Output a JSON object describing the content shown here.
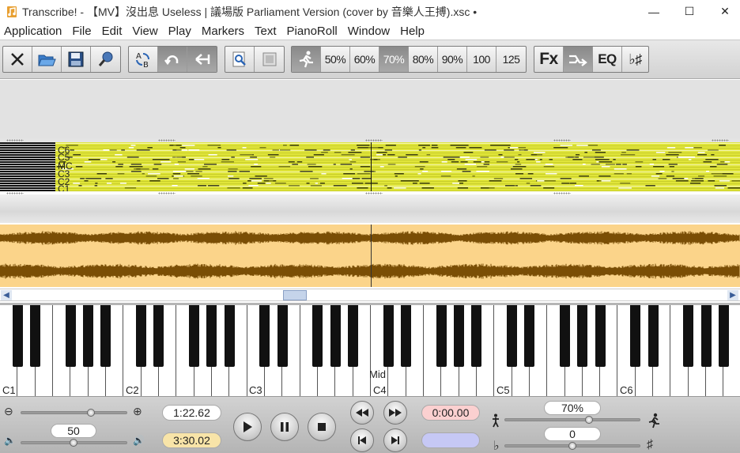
{
  "window": {
    "title": "Transcribe! - 【MV】沒出息 Useless | 議場版 Parliament Version (cover by 音樂人王搏).xsc •",
    "minimize": "—",
    "maximize": "☐",
    "close": "✕"
  },
  "menu": [
    "Application",
    "File",
    "Edit",
    "View",
    "Play",
    "Markers",
    "Text",
    "PianoRoll",
    "Window",
    "Help"
  ],
  "toolbar": {
    "file_icons": [
      "close-file-icon",
      "open-folder-icon",
      "save-disk-icon",
      "microphone-icon"
    ],
    "loop_icons": [
      "ab-loop-icon",
      "loop-icon",
      "back-arrow-icon"
    ],
    "view_icons": [
      "zoom-doc-icon",
      "page-icon"
    ],
    "speeds": [
      "50%",
      "60%",
      "70%",
      "80%",
      "90%",
      "100",
      "125"
    ],
    "active_speed": "70%",
    "fx_label": "Fx",
    "eq_label": "EQ",
    "key_label": "♭♯"
  },
  "pianoroll": {
    "labels": [
      "C6",
      "C5",
      "MC",
      "C3",
      "C2",
      "C1"
    ]
  },
  "keyboard": {
    "octave_labels": [
      "C1",
      "C2",
      "C3",
      "C4",
      "C5",
      "C6"
    ],
    "mid_label": "Mid"
  },
  "controls": {
    "volume": "50",
    "position_time": "1:22.62",
    "total_time": "3:30.02",
    "loop_time": "0:00.00",
    "speed": "70%",
    "pitch": "0",
    "zoom_out_icon": "⊖",
    "zoom_in_icon": "⊕",
    "volume_low_icon": "🔈",
    "volume_high_icon": "🔊",
    "flat_sign": "♭",
    "sharp_sign": "♯"
  },
  "colors": {
    "pianoroll_bg": "#e0e53a",
    "waveform_bg": "#fbd48a",
    "waveform_fg": "#7a4e05",
    "loop_time_bg": "#fbd0d0",
    "total_time_bg": "#f8e4a8",
    "blank_pill_bg": "#c6c8f5"
  }
}
